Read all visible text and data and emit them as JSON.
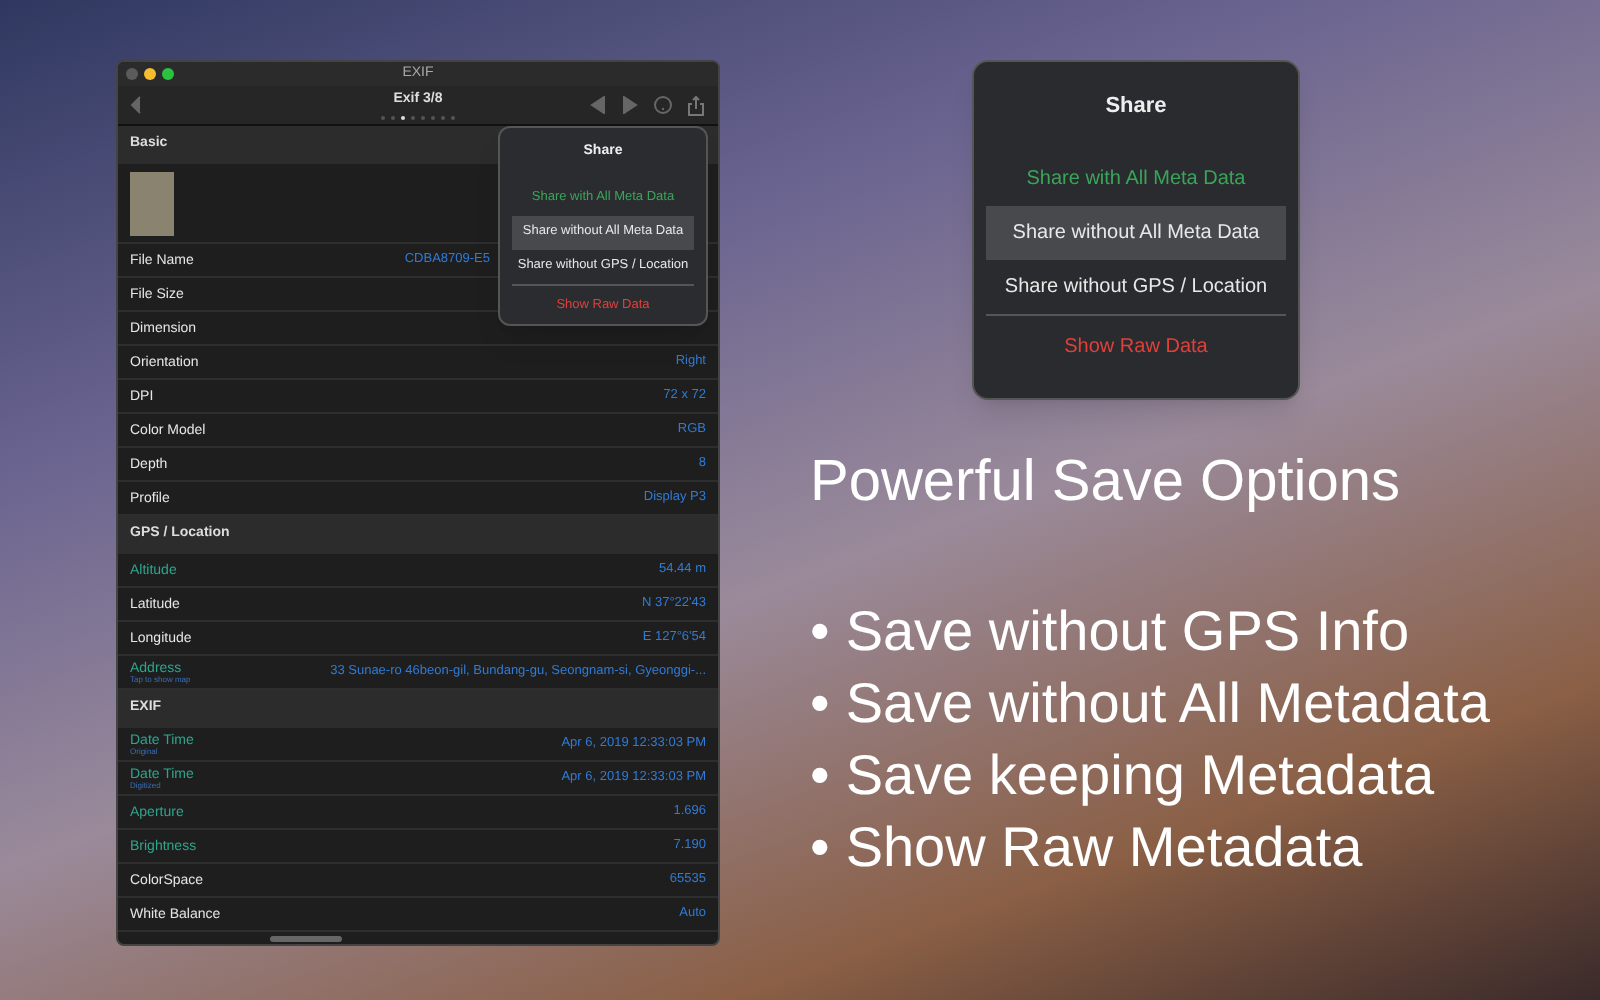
{
  "window": {
    "title": "EXIF"
  },
  "toolbar": {
    "title": "Exif 3/8",
    "page_dots": [
      {
        "selected": false
      },
      {
        "selected": false
      },
      {
        "selected": true
      },
      {
        "selected": false
      },
      {
        "selected": false
      },
      {
        "selected": false
      },
      {
        "selected": false
      },
      {
        "selected": false
      }
    ]
  },
  "sections": [
    {
      "title": "Basic",
      "rows": [
        {
          "kind": "thumbnail"
        },
        {
          "kind": "field",
          "label": "File Name",
          "value": "CDBA8709-E5",
          "color": "#e6e6e6"
        },
        {
          "kind": "field",
          "label": "File Size",
          "color": "#e6e6e6"
        },
        {
          "kind": "field",
          "label": "Dimension",
          "color": "#e6e6e6"
        },
        {
          "kind": "field",
          "label": "Orientation",
          "value": "Right",
          "color": "#e6e6e6"
        },
        {
          "kind": "field",
          "label": "DPI",
          "value": "72 x 72",
          "color": "#e6e6e6"
        },
        {
          "kind": "field",
          "label": "Color Model",
          "value": "RGB",
          "color": "#e6e6e6"
        },
        {
          "kind": "field",
          "label": "Depth",
          "value": "8",
          "color": "#e6e6e6"
        },
        {
          "kind": "field",
          "label": "Profile",
          "value": "Display P3",
          "color": "#e6e6e6"
        }
      ]
    },
    {
      "title": "GPS / Location",
      "rows": [
        {
          "kind": "field",
          "label": "Altitude",
          "value": "54.44 m",
          "color": "#2fa58c"
        },
        {
          "kind": "field",
          "label": "Latitude",
          "value": "N 37°22'43",
          "color": "#e6e6e6"
        },
        {
          "kind": "field",
          "label": "Longitude",
          "value": "E 127°6'54",
          "color": "#e6e6e6"
        },
        {
          "kind": "field",
          "label": "Address",
          "sublabel": "Tap to show map",
          "value": "33 Sunae-ro 46beon-gil, Bundang-gu, Seongnam-si, Gyeonggi-...",
          "color": "#2fa58c"
        }
      ]
    },
    {
      "title": "EXIF",
      "rows": [
        {
          "kind": "field",
          "label": "Date Time",
          "sublabel": "Original",
          "value": "Apr 6, 2019 12:33:03 PM",
          "color": "#2fa58c"
        },
        {
          "kind": "field",
          "label": "Date Time",
          "sublabel": "Digitized",
          "value": "Apr 6, 2019 12:33:03 PM",
          "color": "#2fa58c"
        },
        {
          "kind": "field",
          "label": "Aperture",
          "value": "1.696",
          "color": "#2fa58c"
        },
        {
          "kind": "field",
          "label": "Brightness",
          "value": "7.190",
          "color": "#2fa58c"
        },
        {
          "kind": "field",
          "label": "ColorSpace",
          "value": "65535",
          "color": "#e6e6e6"
        },
        {
          "kind": "field",
          "label": "White Balance",
          "value": "Auto",
          "color": "#e6e6e6"
        }
      ]
    }
  ],
  "share_menu": {
    "title": "Share",
    "items": [
      {
        "label": "Share with All Meta Data",
        "kind": "positive",
        "selected": false
      },
      {
        "label": "Share without All Meta Data",
        "kind": "plain",
        "selected": true
      },
      {
        "label": "Share without GPS / Location",
        "kind": "plain",
        "selected": false
      },
      {
        "label": "Show Raw Data",
        "kind": "destructive",
        "selected": false
      }
    ]
  },
  "share_menu_large": {
    "title": "Share",
    "items": [
      {
        "label": "Share with All Meta Data",
        "kind": "positive",
        "selected": false
      },
      {
        "label": "Share without All Meta Data",
        "kind": "plain",
        "selected": true
      },
      {
        "label": "Share without GPS / Location",
        "kind": "plain",
        "selected": false
      },
      {
        "label": "Show Raw Data",
        "kind": "destructive",
        "selected": false
      }
    ]
  },
  "headline": "Powerful Save Options",
  "bullets": [
    {
      "marker": "•",
      "text": "Save without GPS Info"
    },
    {
      "marker": "•",
      "text": "Save without All Metadata"
    },
    {
      "marker": "•",
      "text": "Save keeping Metadata"
    },
    {
      "marker": "•",
      "text": "Show Raw Metadata"
    }
  ]
}
